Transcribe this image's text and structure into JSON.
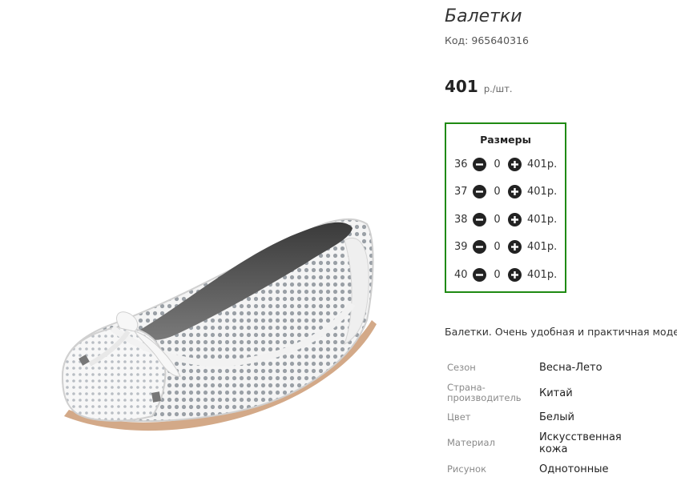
{
  "product": {
    "title": "Балетки",
    "code_label": "Код:",
    "code_value": "965640316",
    "price_value": "401",
    "price_unit": "р./шт.",
    "image_icon": "shoe-photo"
  },
  "sizes": {
    "title": "Размеры",
    "rows": [
      {
        "size": "36",
        "qty": "0",
        "price": "401р."
      },
      {
        "size": "37",
        "qty": "0",
        "price": "401р."
      },
      {
        "size": "38",
        "qty": "0",
        "price": "401р."
      },
      {
        "size": "39",
        "qty": "0",
        "price": "401р."
      },
      {
        "size": "40",
        "qty": "0",
        "price": "401р."
      }
    ],
    "minus_icon": "minus-circle-icon",
    "plus_icon": "plus-circle-icon"
  },
  "description": "Балетки. Очень удобная и практичная моде",
  "specs": [
    {
      "label": "Сезон",
      "value": "Весна-Лето"
    },
    {
      "label": "Страна-производитель",
      "value": "Китай"
    },
    {
      "label": "Цвет",
      "value": "Белый"
    },
    {
      "label": "Материал",
      "value": "Искусственная кожа"
    },
    {
      "label": "Рисунок",
      "value": "Однотонные"
    }
  ],
  "colors": {
    "sizes_border": "#1f8a12",
    "button": "#222222"
  }
}
